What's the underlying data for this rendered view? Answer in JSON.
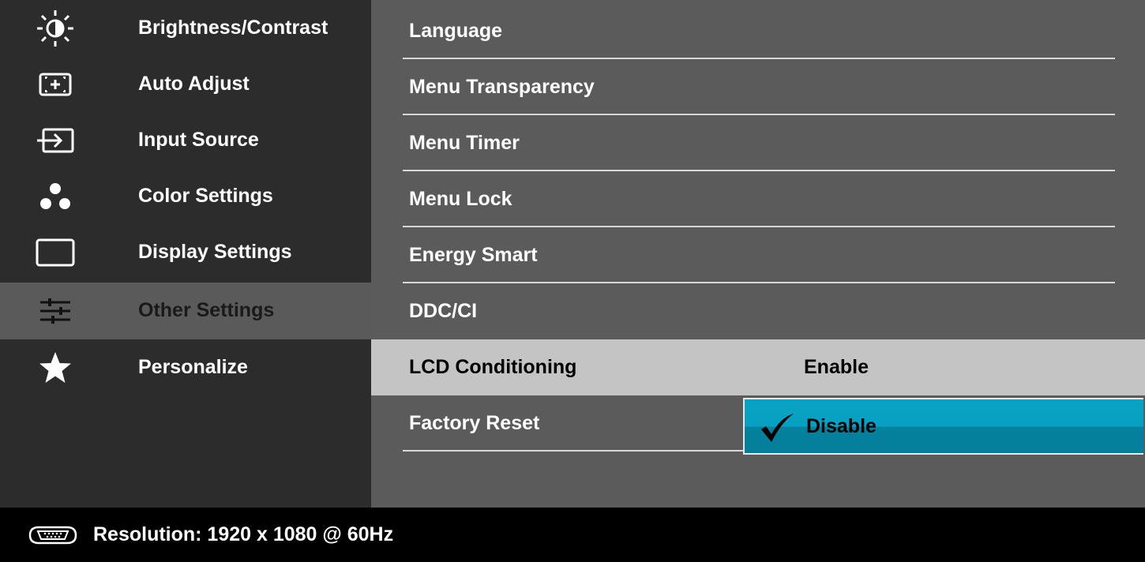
{
  "left_menu": {
    "items": [
      {
        "label": "Brightness/Contrast",
        "icon": "brightness-icon"
      },
      {
        "label": "Auto Adjust",
        "icon": "auto-adjust-icon"
      },
      {
        "label": "Input Source",
        "icon": "input-source-icon"
      },
      {
        "label": "Color Settings",
        "icon": "color-settings-icon"
      },
      {
        "label": "Display Settings",
        "icon": "display-settings-icon"
      },
      {
        "label": "Other Settings",
        "icon": "other-settings-icon",
        "selected": true
      },
      {
        "label": "Personalize",
        "icon": "star-icon"
      }
    ]
  },
  "other_settings": {
    "items": [
      {
        "label": "Language"
      },
      {
        "label": "Menu Transparency"
      },
      {
        "label": "Menu Timer"
      },
      {
        "label": "Menu Lock"
      },
      {
        "label": "Energy Smart"
      },
      {
        "label": "DDC/CI"
      },
      {
        "label": "LCD Conditioning",
        "active": true
      },
      {
        "label": "Factory Reset"
      }
    ],
    "lcd_conditioning_options": {
      "enable": "Enable",
      "disable": "Disable",
      "selected": "Disable"
    }
  },
  "footer": {
    "resolution": "Resolution: 1920 x 1080 @ 60Hz",
    "icon": "vga-connector-icon"
  },
  "colors": {
    "left_bg": "#2c2c2c",
    "left_selected_bg": "#5a5a5a",
    "right_bg": "#5b5b5b",
    "active_row_bg": "#c4c4c4",
    "option_highlight": "#08a0c2",
    "footer_bg": "#000000"
  }
}
